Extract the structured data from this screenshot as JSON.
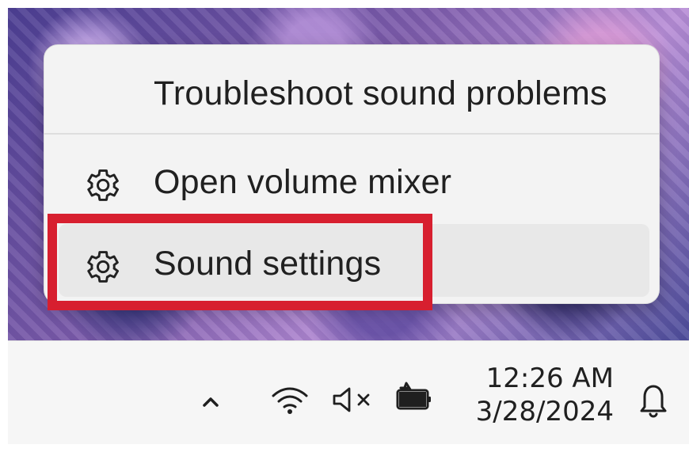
{
  "context_menu": {
    "items": [
      {
        "label": "Troubleshoot sound problems",
        "icon": ""
      },
      {
        "label": "Open volume mixer",
        "icon": "gear-icon"
      },
      {
        "label": "Sound settings",
        "icon": "gear-icon",
        "hovered": true
      }
    ]
  },
  "taskbar": {
    "tray_icons": [
      "chevron-up-icon",
      "wifi-icon",
      "muted-speaker-icon",
      "battery-icon",
      "bell-icon"
    ],
    "time": "12:26 AM",
    "date": "3/28/2024"
  },
  "colors": {
    "highlight": "#d71f2f",
    "menu_background": "#f3f3f3",
    "hover_background": "#e8e8e8",
    "taskbar_background": "#f6f6f6"
  }
}
